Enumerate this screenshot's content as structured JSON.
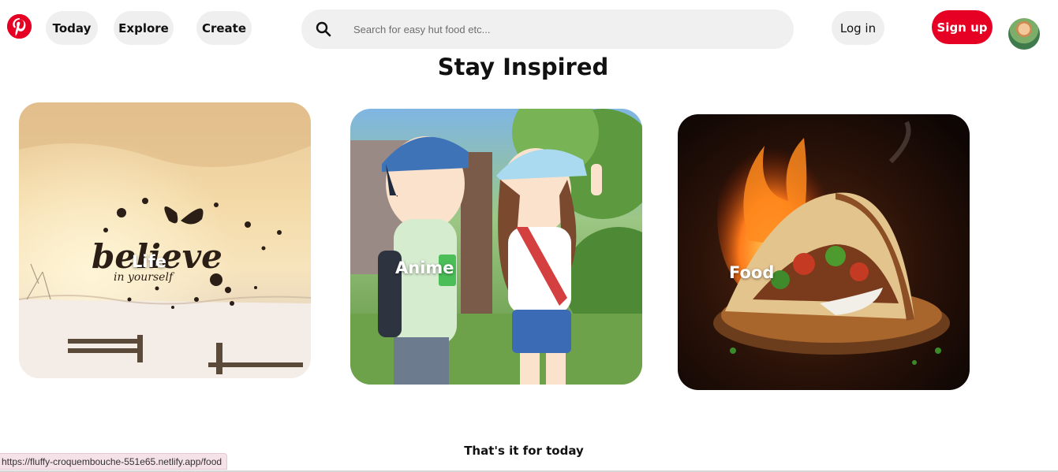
{
  "nav": {
    "today": "Today",
    "explore": "Explore",
    "create": "Create"
  },
  "search": {
    "placeholder": "Search for easy hut food etc..."
  },
  "auth": {
    "login": "Log in",
    "signup": "Sign up"
  },
  "main": {
    "title": "Stay Inspired",
    "cards": [
      {
        "label": "Life",
        "art_text": "believe",
        "art_subtext": "in yourself"
      },
      {
        "label": "Anime"
      },
      {
        "label": "Food"
      }
    ],
    "footer": "That's it for today"
  },
  "status_bar": {
    "url": "https://fluffy-croquembouche-551e65.netlify.app/food"
  },
  "colors": {
    "brand": "#e60023",
    "pill_bg": "#efefef",
    "search_bg": "#f0f0f0"
  },
  "icons": {
    "logo": "pinterest-logo",
    "search": "search-icon"
  }
}
